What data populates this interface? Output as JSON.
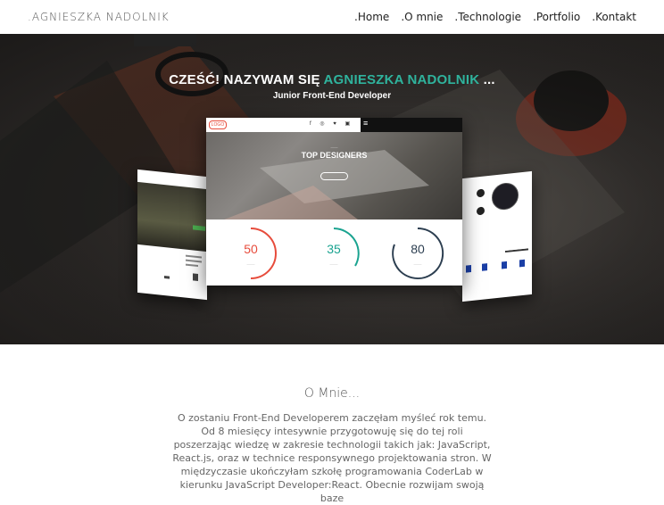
{
  "brand": ".AGNIESZKA NADOLNIK",
  "nav": [
    ".Home",
    ".O mnie",
    ".Technologie",
    ".Portfolio",
    ".Kontakt"
  ],
  "hero": {
    "title_prefix": "CZEŚĆ! NAZYWAM SIĘ",
    "title_name": "AGNIESZKA NADOLNIK",
    "title_suffix": "...",
    "subtitle": "Junior Front-End Developer",
    "accent_color": "#2fb39d"
  },
  "mockup_main": {
    "logo": "LOGO",
    "headline": "TOP DESIGNERS",
    "stats": [
      {
        "value": "50",
        "color": "#e74c3c"
      },
      {
        "value": "35",
        "color": "#1aa390"
      },
      {
        "value": "80",
        "color": "#2c3e50"
      }
    ]
  },
  "about": {
    "title": "O Mnie...",
    "text": "O zostaniu Front-End Developerem zaczęłam myśleć rok temu. Od 8 miesięcy intesywnie przygotowuję się do tej roli poszerzając wiedzę w zakresie technologii takich jak: JavaScript, React.js, oraz w technice responsywnego projektowania stron. W międzyczasie ukończyłam szkołę programowania CoderLab w kierunku JavaScript Developer:React. Obecnie rozwijam swoją baze"
  }
}
